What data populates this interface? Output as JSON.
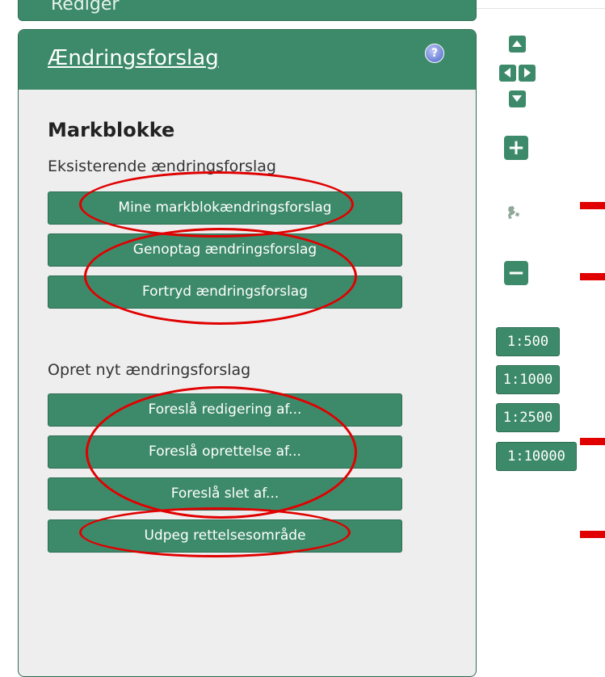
{
  "top_panel": {
    "label": "Redigér"
  },
  "panel": {
    "title": "Ændringsforslag",
    "help_glyph": "?",
    "section_title": "Markblokke",
    "existing_label": "Eksisterende ændringsforslag",
    "existing_buttons": [
      "Mine markblokændringsforslag",
      "Genoptag ændringsforslag",
      "Fortryd ændringsforslag"
    ],
    "new_label": "Opret nyt ændringsforslag",
    "new_buttons": [
      "Foreslå redigering af...",
      "Foreslå oprettelse af...",
      "Foreslå slet af...",
      "Udpeg rettelsesområde"
    ]
  },
  "map_controls": {
    "zoom_in_glyph": "+",
    "zoom_out_glyph": "−",
    "scales": [
      "1:500",
      "1:1000",
      "1:2500",
      "1:10000"
    ]
  },
  "colors": {
    "accent": "#3d8a6a",
    "annotation": "#e00000",
    "panel_bg": "#eeeeee"
  },
  "icons": [
    "pan-up-icon",
    "pan-left-icon",
    "pan-right-icon",
    "pan-down-icon",
    "zoom-in-icon",
    "world-extent-icon",
    "zoom-out-icon",
    "help-icon"
  ]
}
